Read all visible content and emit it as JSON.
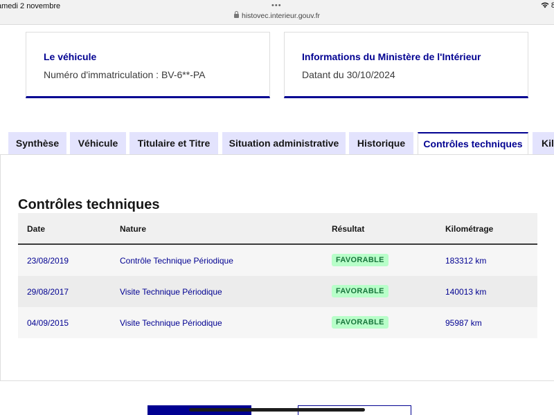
{
  "status_bar": {
    "date": "amedi 2 novembre",
    "url": "histovec.interieur.gouv.fr",
    "battery": "8"
  },
  "cards": [
    {
      "title": "Le véhicule",
      "text": "Numéro d'immatriculation : BV-6**-PA"
    },
    {
      "title": "Informations du Ministère de l'Intérieur",
      "text": "Datant du 30/10/2024"
    }
  ],
  "tabs": [
    {
      "label": "Synthèse"
    },
    {
      "label": "Véhicule"
    },
    {
      "label": "Titulaire et Titre"
    },
    {
      "label": "Situation administrative"
    },
    {
      "label": "Historique"
    },
    {
      "label": "Contrôles techniques"
    },
    {
      "label": "Kil"
    }
  ],
  "section": {
    "title": "Contrôles techniques"
  },
  "table": {
    "headers": [
      "Date",
      "Nature",
      "Résultat",
      "Kilométrage"
    ],
    "rows": [
      {
        "date": "23/08/2019",
        "nature": "Contrôle Technique Périodique",
        "result": "FAVORABLE",
        "km": "183312 km"
      },
      {
        "date": "29/08/2017",
        "nature": "Visite Technique Périodique",
        "result": "FAVORABLE",
        "km": "140013 km"
      },
      {
        "date": "04/09/2015",
        "nature": "Visite Technique Périodique",
        "result": "FAVORABLE",
        "km": "95987 km"
      }
    ]
  },
  "colors": {
    "primary": "#000091",
    "tab_bg": "#e3e3fd",
    "badge_bg": "#b8fec9",
    "badge_text": "#18753c"
  }
}
